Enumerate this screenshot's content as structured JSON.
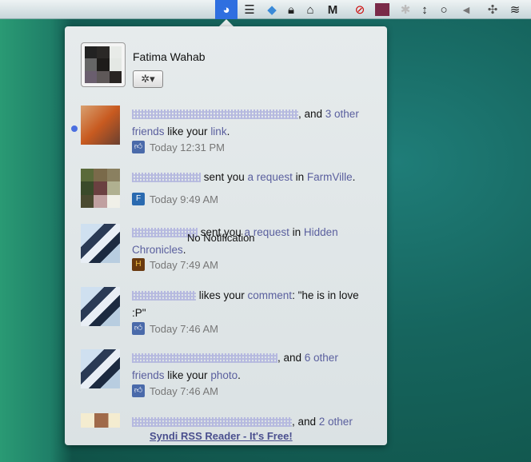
{
  "menubar": {
    "icons": [
      "facebook-notify-icon",
      "wifi-sync-icon",
      "dropbox-icon",
      "lock-icon",
      "bell-icon",
      "gmail-icon",
      "sleep-icon",
      "app-icon",
      "paw-icon",
      "resize-icon",
      "chat-icon",
      "volume-icon",
      "bluetooth-icon",
      "wifi-icon"
    ]
  },
  "profile": {
    "name": "Fatima Wahab",
    "settings_icon": "gear-icon"
  },
  "notifications": [
    {
      "parts": [
        ", and ",
        "3 other friends",
        " like your ",
        "link",
        "."
      ],
      "time": "Today 12:31 PM",
      "unread": true
    },
    {
      "parts": [
        " sent you ",
        "a request",
        " in ",
        "FarmVille",
        "."
      ],
      "time": "Today 9:49 AM"
    },
    {
      "parts": [
        " sent you ",
        "a request",
        " in ",
        "Hidden Chronicles",
        "."
      ],
      "time": "Today 7:49 AM"
    },
    {
      "parts": [
        " likes your ",
        "comment",
        ": \"he is in love :P\""
      ],
      "time": "Today 7:46 AM"
    },
    {
      "parts": [
        ", and ",
        "6 other friends",
        " like your ",
        "photo",
        "."
      ],
      "time": "Today 7:46 AM"
    },
    {
      "parts": [
        ", and ",
        "2 other"
      ]
    }
  ],
  "overlay_text": "No Notification",
  "footer_link": "Syndi RSS Reader - It's Free!"
}
